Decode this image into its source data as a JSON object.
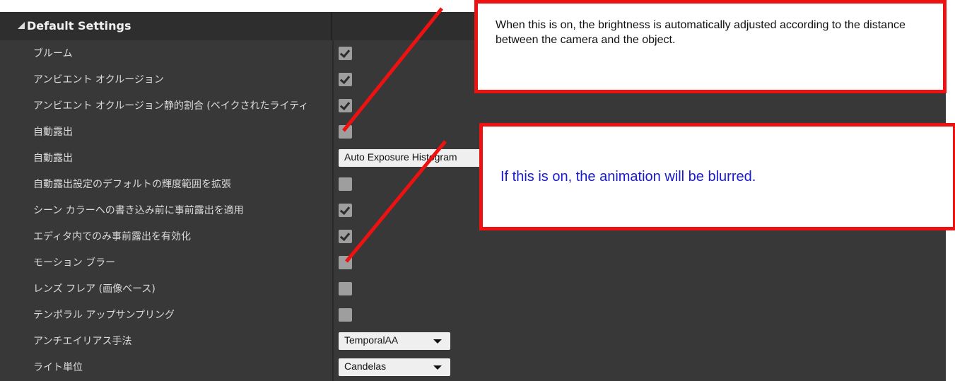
{
  "section": {
    "title": "Default Settings"
  },
  "rows": [
    {
      "label": "ブルーム",
      "control": "checkbox",
      "checked": true
    },
    {
      "label": "アンビエント オクルージョン",
      "control": "checkbox",
      "checked": true
    },
    {
      "label": "アンビエント オクルージョン静的割合 (ベイクされたライティ",
      "control": "checkbox",
      "checked": true
    },
    {
      "label": "自動露出",
      "control": "checkbox",
      "checked": false
    },
    {
      "label": "自動露出",
      "control": "dropdown",
      "value": "Auto Exposure Histogram"
    },
    {
      "label": "自動露出設定のデフォルトの輝度範囲を拡張",
      "control": "checkbox",
      "checked": false
    },
    {
      "label": "シーン カラーへの書き込み前に事前露出を適用",
      "control": "checkbox",
      "checked": true
    },
    {
      "label": "エディタ内でのみ事前露出を有効化",
      "control": "checkbox",
      "checked": true
    },
    {
      "label": "モーション ブラー",
      "control": "checkbox",
      "checked": false
    },
    {
      "label": "レンズ フレア (画像ベース)",
      "control": "checkbox",
      "checked": false
    },
    {
      "label": "テンポラル アップサンプリング",
      "control": "checkbox",
      "checked": false
    },
    {
      "label": "アンチエイリアス手法",
      "control": "dropdown",
      "value": "TemporalAA"
    },
    {
      "label": "ライト単位",
      "control": "dropdown",
      "value": "Candelas"
    }
  ],
  "callouts": {
    "auto_exposure": "When this is on, the brightness is automatically adjusted according to the distance between the camera and the object.",
    "motion_blur": "If this is on, the animation will be blurred."
  },
  "colors": {
    "panel": "#383838",
    "header": "#2e2e2e",
    "callout_border": "#ee1111",
    "callout2_text": "#1a1ad0"
  }
}
